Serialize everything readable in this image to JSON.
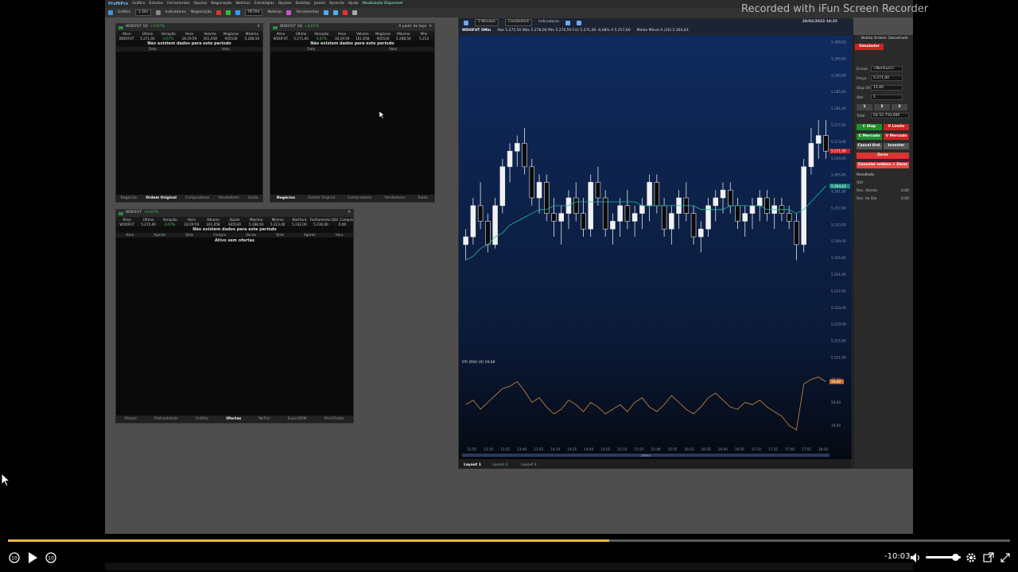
{
  "watermark": "Recorded with iFun Screen Recorder",
  "app": {
    "name": "ProfitPro",
    "menu": [
      "Gráfico",
      "Estudos",
      "Ferramentas",
      "Opções",
      "Negociação",
      "Notícias",
      "Estratégias",
      "Opções",
      "Desktop",
      "Janela",
      "Aprenda",
      "Ajuda",
      "Atualização Disponível"
    ],
    "toolbar_items": [
      "Gráfico",
      "1 Dia",
      "Indicadores",
      "Negociação",
      "PETR4",
      "Notícias",
      "Ferramentas"
    ]
  },
  "panels": {
    "time_sales_1": {
      "title": "WDOFUT 1D",
      "change": "+0,67%",
      "headers": [
        "Ativo",
        "Último",
        "Variação",
        "Hora",
        "Volume",
        "Negócios",
        "Máximo"
      ],
      "row": [
        "WDOFUT",
        "5.271,00",
        "0,67%",
        "18:29:59",
        "161,658",
        "945530",
        "5.288,50"
      ],
      "nodata": "Não existem dados para este período",
      "cols": [
        "Data",
        "Valor"
      ],
      "tabs": [
        "Negócios",
        "Ordem Original",
        "Compradores",
        "Vendedores",
        "Saldo"
      ],
      "active_tab": "Ordem Original"
    },
    "time_sales_2": {
      "title": "WDOFUT 1D",
      "change": "+0,67%",
      "subtitle": "A partir de hoje",
      "headers": [
        "Ativo",
        "Último",
        "Variação",
        "Hora",
        "Volume",
        "Negócios",
        "Máximo",
        "Míni"
      ],
      "row": [
        "WDOFUT",
        "5.271,00",
        "0,67%",
        "18:29:59",
        "161,658",
        "945530",
        "5.288,50",
        "5.213"
      ],
      "nodata": "Não existem dados para este período",
      "cols": [
        "Data",
        "Valor"
      ],
      "tabs": [
        "Negócios",
        "Ordem Original",
        "Compradores",
        "Vendedores",
        "Saldo"
      ],
      "active_tab": "Negócios"
    },
    "book": {
      "title": "WDOFUT",
      "change": "+0,67%",
      "headers": [
        "Ativo",
        "Último",
        "Variação",
        "Hora",
        "Volume",
        "Ajuste",
        "Máximo",
        "Mínimo",
        "Abertura",
        "Fechamento A.",
        "Qtd. Compra"
      ],
      "row": [
        "WDOFUT",
        "5.271,00",
        "0,67%",
        "18:29:59",
        "161,658",
        "945530",
        "5.288,50",
        "5.213,00",
        "5.232,00",
        "5.236,00",
        "0,00"
      ],
      "nodata": "Não existem dados para este período",
      "cols": [
        "Hora",
        "Agente",
        "Qtde",
        "Compra",
        "Venda",
        "Qtde",
        "Agente",
        "Hora"
      ],
      "empty": "Ativo sem ofertas",
      "tabs": [
        "Preços",
        "Profundidade",
        "Gráfico",
        "Ofertas",
        "NoTrix",
        "SuperDOM",
        "PriceTrader"
      ],
      "active_tab": "Ofertas"
    }
  },
  "chart": {
    "toolbar": [
      "5 Minutos",
      "Candlestick",
      "Indicadores"
    ],
    "date_time": "28/02/2023 18:25",
    "legend": "WDOFUT 5Min",
    "ohlc": "Abe 5.275,50 Máx 5.278,00 Mín 5.270,50 Fch 5.271,00 -0,08% A 5.257,60",
    "ma_label": "Média Móvel A (20) 5.264,63",
    "ifr_label": "IFR (RSI) (9) 19,68",
    "layouts": [
      "Layout 1",
      "Layout 2",
      "Layout 3"
    ],
    "active_layout": "Layout 1",
    "date_label": "28/fev",
    "price_badge": "5.271,00",
    "ma_badge": "5.264,63",
    "rsi_badge": "19,68"
  },
  "chart_data": {
    "type": "candlestick",
    "x_ticks": [
      "12:55",
      "13:10",
      "13:25",
      "13:40",
      "13:55",
      "14:10",
      "14:25",
      "14:40",
      "14:55",
      "15:10",
      "15:25",
      "15:40",
      "15:55",
      "16:10",
      "16:25",
      "16:40",
      "16:55",
      "17:10",
      "17:25",
      "17:40",
      "17:55",
      "18:10"
    ],
    "y_ticks": [
      "5.300,00",
      "5.295,00",
      "5.290,00",
      "5.285,00",
      "5.281,00",
      "5.277,00",
      "5.273,00",
      "5.269,00",
      "5.265,00",
      "5.261,00",
      "5.257,00",
      "5.253,00",
      "5.249,00",
      "5.245,00",
      "5.241,00",
      "5.237,00",
      "5.233,00",
      "5.229,00",
      "5.225,00",
      "5.221,00"
    ],
    "ylim": [
      5221,
      5302
    ],
    "candles": [
      [
        5250,
        5254,
        5246,
        5252
      ],
      [
        5252,
        5262,
        5250,
        5260
      ],
      [
        5260,
        5266,
        5254,
        5256
      ],
      [
        5256,
        5258,
        5248,
        5250
      ],
      [
        5250,
        5262,
        5249,
        5260
      ],
      [
        5260,
        5272,
        5258,
        5270
      ],
      [
        5270,
        5276,
        5266,
        5274
      ],
      [
        5274,
        5278,
        5270,
        5276
      ],
      [
        5276,
        5280,
        5268,
        5270
      ],
      [
        5270,
        5272,
        5260,
        5262
      ],
      [
        5262,
        5268,
        5258,
        5266
      ],
      [
        5266,
        5268,
        5256,
        5258
      ],
      [
        5258,
        5262,
        5252,
        5256
      ],
      [
        5256,
        5260,
        5250,
        5258
      ],
      [
        5258,
        5264,
        5254,
        5262
      ],
      [
        5262,
        5266,
        5256,
        5258
      ],
      [
        5258,
        5262,
        5252,
        5254
      ],
      [
        5254,
        5268,
        5252,
        5266
      ],
      [
        5266,
        5270,
        5260,
        5262
      ],
      [
        5262,
        5264,
        5252,
        5254
      ],
      [
        5254,
        5258,
        5250,
        5256
      ],
      [
        5256,
        5262,
        5252,
        5260
      ],
      [
        5260,
        5264,
        5254,
        5256
      ],
      [
        5256,
        5260,
        5252,
        5258
      ],
      [
        5258,
        5262,
        5254,
        5260
      ],
      [
        5260,
        5268,
        5256,
        5266
      ],
      [
        5266,
        5268,
        5258,
        5260
      ],
      [
        5260,
        5262,
        5252,
        5254
      ],
      [
        5254,
        5260,
        5250,
        5258
      ],
      [
        5258,
        5264,
        5254,
        5262
      ],
      [
        5262,
        5266,
        5256,
        5258
      ],
      [
        5258,
        5260,
        5250,
        5252
      ],
      [
        5252,
        5256,
        5248,
        5254
      ],
      [
        5254,
        5262,
        5252,
        5260
      ],
      [
        5260,
        5264,
        5256,
        5262
      ],
      [
        5262,
        5266,
        5258,
        5264
      ],
      [
        5264,
        5266,
        5258,
        5260
      ],
      [
        5260,
        5262,
        5254,
        5256
      ],
      [
        5256,
        5260,
        5252,
        5258
      ],
      [
        5258,
        5262,
        5254,
        5260
      ],
      [
        5260,
        5264,
        5256,
        5262
      ],
      [
        5262,
        5264,
        5256,
        5258
      ],
      [
        5258,
        5262,
        5254,
        5260
      ],
      [
        5260,
        5262,
        5256,
        5258
      ],
      [
        5258,
        5260,
        5254,
        5256
      ],
      [
        5256,
        5258,
        5246,
        5250
      ],
      [
        5250,
        5272,
        5248,
        5270
      ],
      [
        5270,
        5280,
        5268,
        5276
      ],
      [
        5276,
        5282,
        5272,
        5278
      ],
      [
        5278,
        5282,
        5272,
        5274
      ]
    ],
    "ma": [
      5246,
      5247,
      5249,
      5250,
      5252,
      5253,
      5255,
      5256,
      5257,
      5258,
      5259,
      5259,
      5260,
      5260,
      5260,
      5261,
      5261,
      5261,
      5261,
      5261,
      5261,
      5261,
      5261,
      5261,
      5260,
      5260,
      5260,
      5260,
      5260,
      5260,
      5260,
      5260,
      5259,
      5259,
      5259,
      5259,
      5260,
      5260,
      5260,
      5260,
      5260,
      5259,
      5259,
      5259,
      5259,
      5258,
      5259,
      5261,
      5263,
      5265
    ],
    "rsi": {
      "ylim": [
        20,
        80
      ],
      "ticks": [
        "70,00",
        "50,00",
        "30,00"
      ],
      "values": [
        48,
        52,
        44,
        50,
        56,
        62,
        64,
        68,
        60,
        50,
        54,
        46,
        40,
        44,
        52,
        48,
        42,
        50,
        46,
        40,
        44,
        48,
        42,
        50,
        54,
        46,
        42,
        48,
        56,
        50,
        44,
        40,
        46,
        54,
        58,
        52,
        46,
        44,
        50,
        48,
        52,
        46,
        42,
        38,
        30,
        26,
        66,
        70,
        72,
        68
      ]
    }
  },
  "order_panel": {
    "title": "Boleta Ordem: Daisetrado",
    "mode": "Simulador",
    "fields": [
      {
        "label": "Enviar",
        "value": "<Nenhum>"
      },
      {
        "label": "Preço",
        "value": "5.271,00"
      },
      {
        "label": "Stop Of.",
        "value": "15,00"
      },
      {
        "label": "Qtd",
        "value": "1"
      }
    ],
    "qty_presets": [
      "1",
      "2",
      "3"
    ],
    "total_label": "Total",
    "total_value": "R$ 52.710,000",
    "buttons": {
      "c_stop": "C Stop",
      "v_limite": "V Limite",
      "c_mercado": "C Mercado",
      "v_mercado": "V Mercado",
      "cancel": "Cancel Ord.",
      "inverter": "Inverter",
      "zerar": "Zerar",
      "cancel_zerar": "Cancelar ordens + Zerar"
    },
    "result_label": "Resultado",
    "result_rows": [
      {
        "label": "Qtd",
        "value": ""
      },
      {
        "label": "Res. Aberto",
        "value": "0,00"
      },
      {
        "label": "Res. do Dia",
        "value": "0,00"
      }
    ]
  },
  "player": {
    "time_remaining": "-10:03",
    "progress": 0.6,
    "volume": 0.8
  }
}
